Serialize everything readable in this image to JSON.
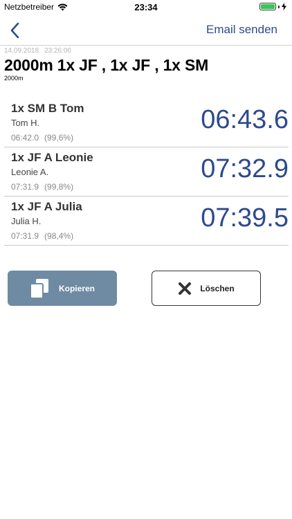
{
  "status_bar": {
    "carrier": "Netzbetreiber",
    "time": "23:34",
    "battery_percent": 100,
    "battery_color": "#34c759"
  },
  "nav": {
    "back_icon": "chevron-left-icon",
    "email_label": "Email senden"
  },
  "header": {
    "date": "14.09.2018",
    "time": "23:26:06",
    "title": "2000m 1x JF , 1x JF , 1x SM",
    "subtitle": "2000m"
  },
  "results": [
    {
      "crew": "1x SM B Tom",
      "rower": "Tom H.",
      "reference": "06:42.0",
      "percent": "(99,6%)",
      "time": "06:43.6"
    },
    {
      "crew": "1x JF A Leonie",
      "rower": "Leonie A.",
      "reference": "07:31.9",
      "percent": "(99,8%)",
      "time": "07:32.9"
    },
    {
      "crew": "1x JF A Julia",
      "rower": "Julia H.",
      "reference": "07:31.9",
      "percent": "(98,4%)",
      "time": "07:39.5"
    }
  ],
  "actions": {
    "copy_label": "Kopieren",
    "copy_icon": "copy-icon",
    "delete_label": "Löschen",
    "delete_icon": "close-x-icon"
  },
  "colors": {
    "accent": "#2c4a8c",
    "copy_button": "#6f8aa3"
  }
}
